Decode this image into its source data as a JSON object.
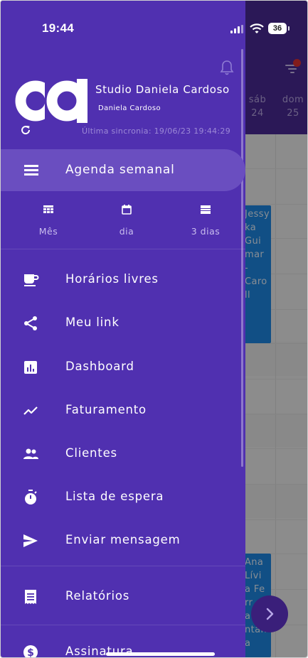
{
  "status_bar": {
    "time": "19:44",
    "battery": "36"
  },
  "calendar_background": {
    "days": [
      {
        "name": "sáb",
        "number": "24"
      },
      {
        "name": "dom",
        "number": "25"
      }
    ],
    "events": [
      {
        "lines": [
          "Jessy",
          "ka",
          "Gui",
          "mar",
          "-",
          "Caro",
          "ll"
        ]
      },
      {
        "lines": [
          "Ana",
          "Lívi",
          "a Fe",
          "rr",
          "a",
          "ntan",
          "a"
        ]
      }
    ]
  },
  "drawer": {
    "studio_name": "Studio Daniela Cardoso",
    "owner_name": "Daniela Cardoso",
    "last_sync": "Última sincronia: 19/06/23 19:44:29",
    "weekly_label": "Agenda semanal",
    "view_options": [
      {
        "label": "Mês",
        "icon": "grid-calendar-icon"
      },
      {
        "label": "dia",
        "icon": "calendar-icon"
      },
      {
        "label": "3 dias",
        "icon": "three-days-icon"
      }
    ],
    "menu": [
      {
        "label": "Horários livres",
        "icon": "coffee-cup-icon"
      },
      {
        "label": "Meu link",
        "icon": "share-icon"
      },
      {
        "label": "Dashboard",
        "icon": "bar-chart-icon"
      },
      {
        "label": "Faturamento",
        "icon": "trending-up-icon"
      },
      {
        "label": "Clientes",
        "icon": "people-icon"
      },
      {
        "label": "Lista de espera",
        "icon": "stopwatch-icon"
      },
      {
        "label": "Enviar mensagem",
        "icon": "send-icon"
      },
      {
        "label": "Relatórios",
        "icon": "receipt-icon"
      },
      {
        "label": "Assinatura",
        "icon": "dollar-circle-icon"
      }
    ]
  },
  "colors": {
    "drawer_bg": "#5030b0",
    "selected_item_bg": "#6a4ec0",
    "header_bg": "#4a2a96",
    "event_bg": "#1e88e5",
    "notification_dot": "#e03131"
  }
}
